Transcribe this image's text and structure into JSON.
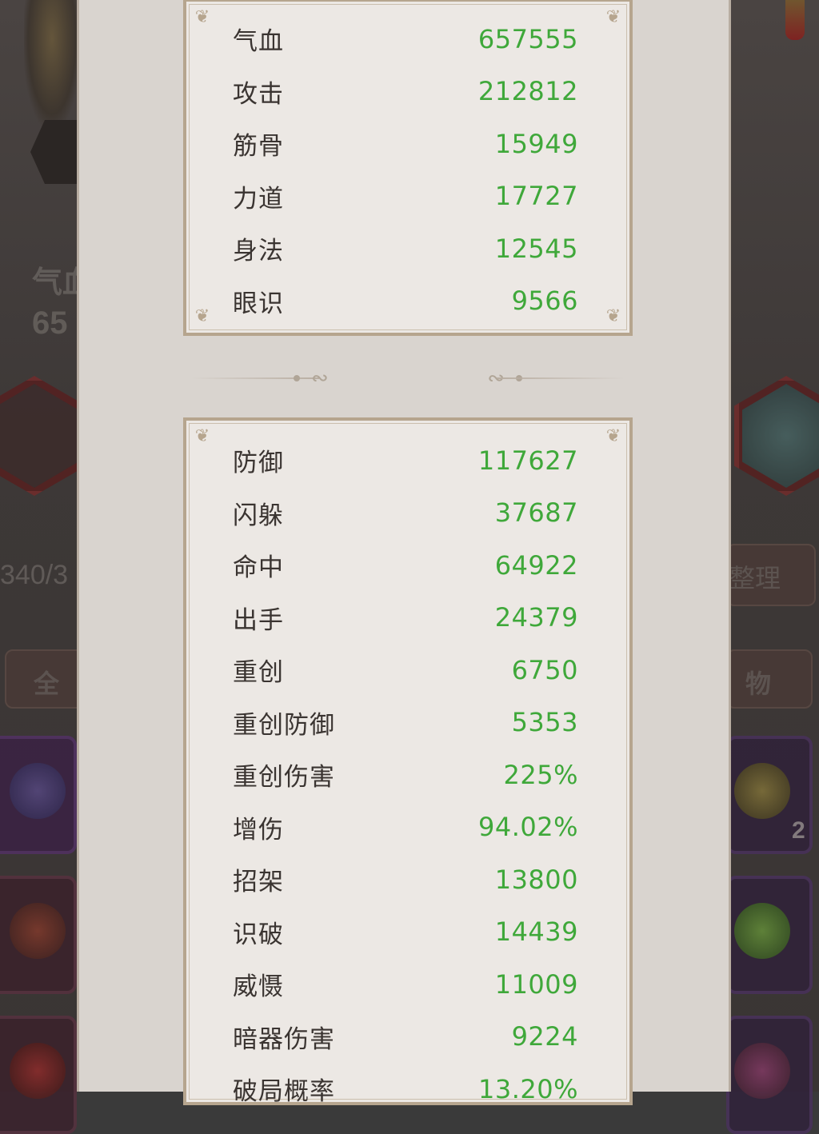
{
  "background": {
    "left_vitality_label": "气血",
    "left_vitality_value": "65",
    "left_bag_count": "340/3",
    "left_tab_label": "全",
    "right_sort_button": "整理",
    "right_tab_label": "物",
    "right_item_count": "2"
  },
  "basic_stats": [
    {
      "label": "气血",
      "value": "657555"
    },
    {
      "label": "攻击",
      "value": "212812"
    },
    {
      "label": "筋骨",
      "value": "15949"
    },
    {
      "label": "力道",
      "value": "17727"
    },
    {
      "label": "身法",
      "value": "12545"
    },
    {
      "label": "眼识",
      "value": "9566"
    }
  ],
  "advanced_stats": [
    {
      "label": "防御",
      "value": "117627"
    },
    {
      "label": "闪躲",
      "value": "37687"
    },
    {
      "label": "命中",
      "value": "64922"
    },
    {
      "label": "出手",
      "value": "24379"
    },
    {
      "label": "重创",
      "value": "6750"
    },
    {
      "label": "重创防御",
      "value": "5353"
    },
    {
      "label": "重创伤害",
      "value": "225%"
    },
    {
      "label": "增伤",
      "value": "94.02%"
    },
    {
      "label": "招架",
      "value": "13800"
    },
    {
      "label": "识破",
      "value": "14439"
    },
    {
      "label": "威慑",
      "value": "11009"
    },
    {
      "label": "暗器伤害",
      "value": "9224"
    },
    {
      "label": "破局概率",
      "value": "13.20%"
    }
  ],
  "colors": {
    "value_green": "#3fa83a",
    "label_dark": "#3a3431",
    "card_border": "#b6a58e",
    "panel_bg": "#d9d4cf"
  }
}
